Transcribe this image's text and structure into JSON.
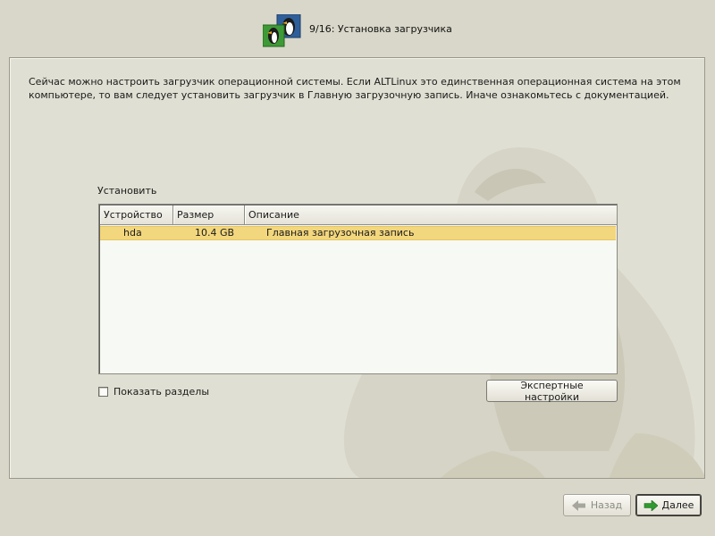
{
  "header": {
    "step_title": "9/16: Установка загрузчика"
  },
  "intro_text": "Сейчас можно настроить загрузчик операционной системы. Если ALTLinux это единственная операционная система на этом компьютере, то вам следует установить загрузчик в Главную загрузочную запись. Иначе ознакомьтесь с документацией.",
  "install": {
    "label": "Установить",
    "columns": [
      "Устройство",
      "Размер",
      "Описание"
    ],
    "rows": [
      {
        "device": "hda",
        "size": "10.4 GB",
        "description": "Главная загрузочная запись",
        "selected": true
      }
    ]
  },
  "show_partitions": {
    "label": "Показать разделы",
    "checked": false
  },
  "buttons": {
    "expert": "Экспертные настройки",
    "back": "Назад",
    "next": "Далее"
  },
  "colors": {
    "background": "#d9d7c9",
    "selected_row": "#f3d77e",
    "arrow_enabled": "#2f9a2f",
    "arrow_disabled": "#a7a69d"
  },
  "icons": {
    "logo": "alt-penguin-logo-icon",
    "back": "arrow-left-icon",
    "next": "arrow-right-icon"
  }
}
